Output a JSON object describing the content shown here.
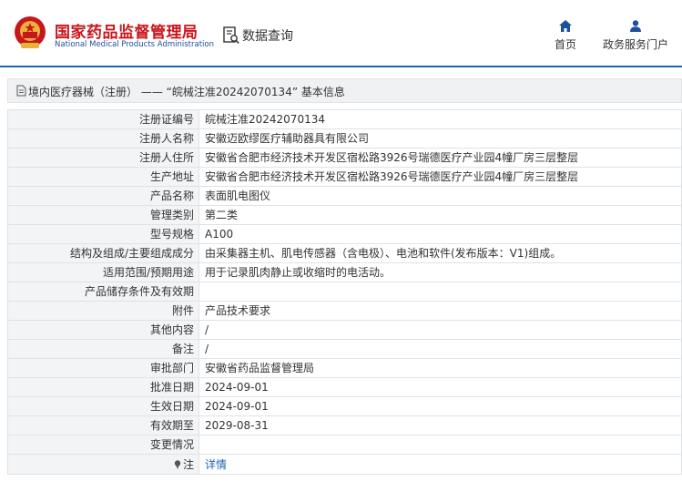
{
  "header": {
    "site_title_cn": "国家药品监督管理局",
    "site_title_en": "National Medical Products Administration",
    "query_label": "数据查询",
    "nav_home": "首页",
    "nav_gov_service": "政务服务门户"
  },
  "breadcrumb": {
    "text": "境内医疗器械（注册） ——  “皖械注准20242070134” 基本信息"
  },
  "table": {
    "rows": [
      {
        "label": "注册证编号",
        "value": "皖械注准20242070134"
      },
      {
        "label": "注册人名称",
        "value": "安徽迈欧缪医疗辅助器具有限公司"
      },
      {
        "label": "注册人住所",
        "value": "安徽省合肥市经济技术开发区宿松路3926号瑞德医疗产业园4幢厂房三层整层"
      },
      {
        "label": "生产地址",
        "value": "安徽省合肥市经济技术开发区宿松路3926号瑞德医疗产业园4幢厂房三层整层"
      },
      {
        "label": "产品名称",
        "value": "表面肌电图仪"
      },
      {
        "label": "管理类别",
        "value": "第二类"
      },
      {
        "label": "型号规格",
        "value": "A100"
      },
      {
        "label": "结构及组成/主要组成成分",
        "value": "由采集器主机、肌电传感器（含电极）、电池和软件(发布版本：V1)组成。"
      },
      {
        "label": "适用范围/预期用途",
        "value": "用于记录肌肉静止或收缩时的电活动。"
      },
      {
        "label": "产品储存条件及有效期",
        "value": ""
      },
      {
        "label": "附件",
        "value": "产品技术要求"
      },
      {
        "label": "其他内容",
        "value": "/"
      },
      {
        "label": "备注",
        "value": "/"
      },
      {
        "label": "审批部门",
        "value": "安徽省药品监督管理局"
      },
      {
        "label": "批准日期",
        "value": "2024-09-01"
      },
      {
        "label": "生效日期",
        "value": "2024-09-01"
      },
      {
        "label": "有效期至",
        "value": "2029-08-31"
      },
      {
        "label": "变更情况",
        "value": ""
      }
    ],
    "note_label": "注",
    "note_link": "详情"
  },
  "colors": {
    "brand_red": "#c8161d",
    "brand_blue": "#1d64b4",
    "label_bg": "#f3f4f6"
  }
}
